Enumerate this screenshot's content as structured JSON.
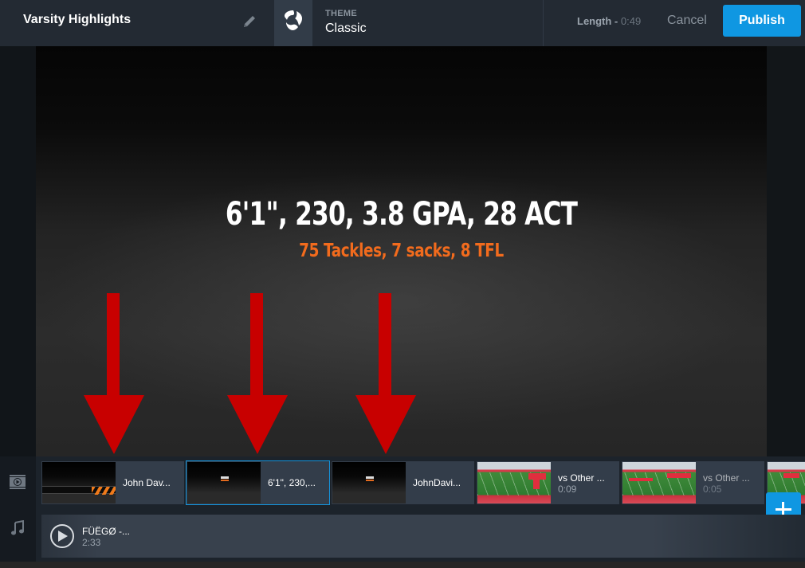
{
  "header": {
    "title": "Varsity Highlights",
    "theme_label": "THEME",
    "theme_value": "Classic",
    "length_label": "Length - ",
    "length_value": "0:49",
    "cancel_label": "Cancel",
    "publish_label": "Publish"
  },
  "colors": {
    "accent": "#0f97e2",
    "header_bg": "#232a33",
    "arrow_red": "#c80000",
    "subtitle_orange": "#f26b1d"
  },
  "preview": {
    "headline": "6'1\", 230, 3.8 GPA, 28 ACT",
    "subline": "75 Tackles, 7 sacks, 8 TFL",
    "arrows_count": 3
  },
  "timeline": {
    "video_icon": "film-play-icon",
    "music_icon": "music-note-icon",
    "clips": [
      {
        "name": "John Dav...",
        "duration": "",
        "thumb": "title-card-stripes",
        "selected": false
      },
      {
        "name": "6'1\", 230,...",
        "duration": "",
        "thumb": "title-card",
        "selected": true
      },
      {
        "name": "JohnDavi...",
        "duration": "",
        "thumb": "title-card",
        "selected": false
      },
      {
        "name": "vs Other ...",
        "duration": "0:09",
        "thumb": "football-field",
        "selected": false
      },
      {
        "name": "vs Other ...",
        "duration": "0:05",
        "thumb": "football-field",
        "selected": false
      }
    ],
    "audio": {
      "name": "FÜËGØ -...",
      "duration": "2:33"
    }
  }
}
